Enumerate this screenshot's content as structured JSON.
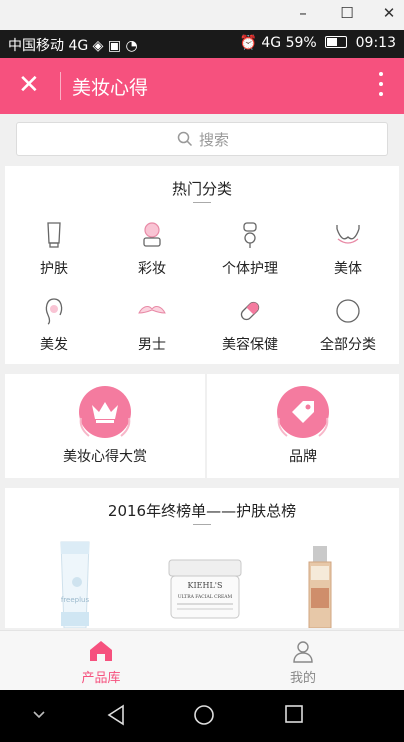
{
  "window": {
    "minimize": "–",
    "maximize": "☐",
    "close": "✕"
  },
  "status_bar": {
    "left": "中国移动 4G ◈ ▣ ◔",
    "signal": "⏰ 4G",
    "battery": "59%",
    "time": "09:13"
  },
  "header": {
    "close": "✕",
    "title": "美妆心得",
    "accent": "#f6517e"
  },
  "search": {
    "placeholder": "搜索"
  },
  "hot_categories": {
    "title": "热门分类",
    "items": [
      {
        "label": "护肤",
        "icon": "skincare-tube-icon"
      },
      {
        "label": "彩妆",
        "icon": "makeup-compact-icon"
      },
      {
        "label": "个体护理",
        "icon": "razor-icon"
      },
      {
        "label": "美体",
        "icon": "bra-icon"
      },
      {
        "label": "美发",
        "icon": "hair-icon"
      },
      {
        "label": "男士",
        "icon": "mustache-icon"
      },
      {
        "label": "美容保健",
        "icon": "pill-icon"
      },
      {
        "label": "全部分类",
        "icon": "circle-icon"
      }
    ]
  },
  "features": [
    {
      "label": "美妆心得大赏",
      "icon": "crown-icon"
    },
    {
      "label": "品牌",
      "icon": "tag-icon"
    }
  ],
  "ranking": {
    "title": "2016年终榜单——护肤总榜",
    "products": [
      {
        "icon": "cleanser-tube-icon",
        "brand": "freeplus"
      },
      {
        "icon": "cream-jar-icon",
        "brand": "KIEHL'S",
        "name": "ULTRA FACIAL CREAM"
      },
      {
        "icon": "essence-bottle-icon",
        "brand": ""
      }
    ]
  },
  "tabbar": {
    "items": [
      {
        "label": "产品库",
        "icon": "home-icon",
        "active": true,
        "color": "#f6517e"
      },
      {
        "label": "我的",
        "icon": "user-icon",
        "active": false,
        "color": "#888888"
      }
    ]
  },
  "nav": {
    "items": [
      "chevron-down-icon",
      "back-triangle-icon",
      "home-circle-icon",
      "recents-square-icon"
    ]
  }
}
